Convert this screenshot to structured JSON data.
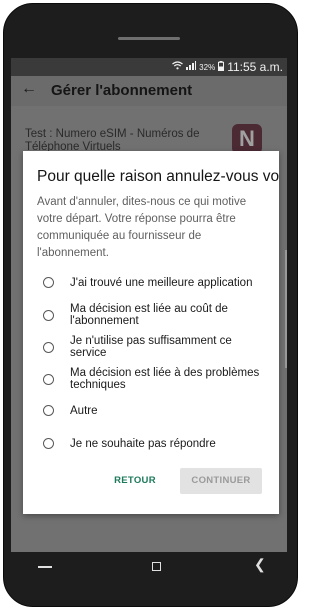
{
  "status_bar": {
    "battery": "32%",
    "time": "11:55 a.m."
  },
  "app_bar": {
    "title": "Gérer l'abonnement"
  },
  "subscription": {
    "title": "Test : Numero eSIM - Numéros de Téléphone Virtuels"
  },
  "dialog": {
    "title": "Pour quelle raison annulez-vous votre abonnement ?",
    "description": "Avant d'annuler, dites-nous ce qui motive votre départ. Votre réponse pourra être communiquée au fournisseur de l'abonnement.",
    "options": [
      "J'ai trouvé une meilleure application",
      "Ma décision est liée au coût de l'abonnement",
      "Je n'utilise pas suffisamment ce service",
      "Ma décision est liée à des problèmes techniques",
      "Autre",
      "Je ne souhaite pas répondre"
    ],
    "back_label": "RETOUR",
    "continue_label": "CONTINUER"
  },
  "colors": {
    "accent": "#1c7a5a",
    "scrim_app_bar": "#6b6b6b",
    "disabled_button": "#e2e2e2"
  },
  "icons": {
    "back": "arrow-left-icon",
    "wifi": "wifi-icon",
    "signal": "signal-icon",
    "battery": "battery-icon",
    "nav_recent": "recent-apps-icon",
    "nav_home": "home-icon",
    "nav_back": "nav-back-icon"
  }
}
